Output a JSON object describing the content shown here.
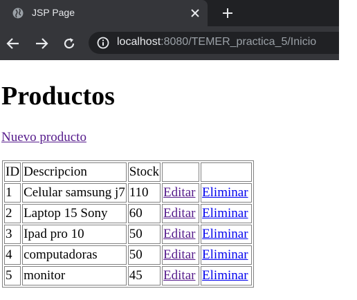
{
  "browser": {
    "tab_title": "JSP Page",
    "url_host": "localhost",
    "url_rest": ":8080/TEMER_practica_5/Inicio",
    "colors": {
      "frame": "#202124",
      "toolbar": "#35363a",
      "text": "#e8eaed",
      "muted": "#9aa0a6"
    }
  },
  "page": {
    "heading": "Productos",
    "new_product_link": "Nuevo producto",
    "table": {
      "headers": [
        "ID",
        "Descripcion",
        "Stock",
        "",
        ""
      ],
      "rows": [
        {
          "id": "1",
          "descripcion": "Celular samsung j7",
          "stock": "110",
          "edit": "Editar",
          "delete": "Eliminar"
        },
        {
          "id": "2",
          "descripcion": "Laptop 15 Sony",
          "stock": "60",
          "edit": "Editar",
          "delete": "Eliminar"
        },
        {
          "id": "3",
          "descripcion": "Ipad pro 10",
          "stock": "50",
          "edit": "Editar",
          "delete": "Eliminar"
        },
        {
          "id": "4",
          "descripcion": "computadoras",
          "stock": "50",
          "edit": "Editar",
          "delete": "Eliminar"
        },
        {
          "id": "5",
          "descripcion": "monitor",
          "stock": "45",
          "edit": "Editar",
          "delete": "Eliminar"
        }
      ]
    },
    "colors": {
      "link_visited": "#551a8b",
      "link_unvisited": "#0000ee"
    }
  }
}
